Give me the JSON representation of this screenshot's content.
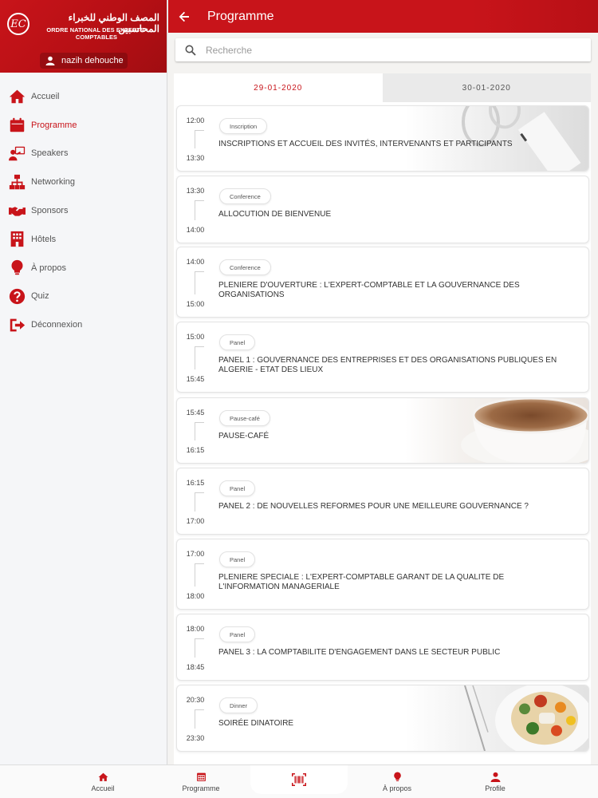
{
  "sidebar": {
    "logo_mark": "EC",
    "org_name_ar": "المصف الوطني للخبراء المحاسبين",
    "org_name_fr": "ORDRE NATIONAL DES EXPERTS-COMPTABLES",
    "user_name": "nazih dehouche",
    "items": [
      {
        "label": "Accueil",
        "icon": "home-icon"
      },
      {
        "label": "Programme",
        "icon": "calendar-icon",
        "active": true
      },
      {
        "label": "Speakers",
        "icon": "presenter-icon"
      },
      {
        "label": "Networking",
        "icon": "network-icon"
      },
      {
        "label": "Sponsors",
        "icon": "handshake-icon"
      },
      {
        "label": "Hôtels",
        "icon": "hotel-icon"
      },
      {
        "label": "À propos",
        "icon": "lightbulb-icon"
      },
      {
        "label": "Quiz",
        "icon": "question-icon"
      },
      {
        "label": "Déconnexion",
        "icon": "logout-icon"
      }
    ]
  },
  "header": {
    "title": "Programme"
  },
  "search": {
    "placeholder": "Recherche"
  },
  "tabs": [
    {
      "label": "29-01-2020",
      "active": true
    },
    {
      "label": "30-01-2020",
      "active": false
    }
  ],
  "sessions": [
    {
      "start": "12:00",
      "end": "13:30",
      "type": "Inscription",
      "title": "INSCRIPTIONS ET ACCUEIL DES INVITÉS, INTERVENANTS ET PARTICIPANTS",
      "image": "desk-image"
    },
    {
      "start": "13:30",
      "end": "14:00",
      "type": "Conference",
      "title": "ALLOCUTION DE BIENVENUE"
    },
    {
      "start": "14:00",
      "end": "15:00",
      "type": "Conference",
      "title": "PLENIERE D'OUVERTURE : L'EXPERT-COMPTABLE ET LA GOUVERNANCE DES ORGANISATIONS"
    },
    {
      "start": "15:00",
      "end": "15:45",
      "type": "Panel",
      "title": "PANEL 1 : GOUVERNANCE DES ENTREPRISES ET DES ORGANISATIONS PUBLIQUES EN ALGERIE - ETAT DES LIEUX"
    },
    {
      "start": "15:45",
      "end": "16:15",
      "type": "Pause-café",
      "title": "PAUSE-CAFÉ",
      "image": "coffee-image"
    },
    {
      "start": "16:15",
      "end": "17:00",
      "type": "Panel",
      "title": "PANEL 2 : DE NOUVELLES REFORMES POUR UNE MEILLEURE GOUVERNANCE ?"
    },
    {
      "start": "17:00",
      "end": "18:00",
      "type": "Panel",
      "title": "PLENIERE SPECIALE : L'EXPERT-COMPTABLE GARANT DE LA QUALITE DE L'INFORMATION MANAGERIALE"
    },
    {
      "start": "18:00",
      "end": "18:45",
      "type": "Panel",
      "title": "PANEL 3 : LA COMPTABILITE D'ENGAGEMENT DANS LE SECTEUR PUBLIC"
    },
    {
      "start": "20:30",
      "end": "23:30",
      "type": "Dinner",
      "title": "SOIRÉE DINATOIRE",
      "image": "food-image"
    }
  ],
  "bottom_nav": [
    {
      "label": "Accueil",
      "icon": "home-icon"
    },
    {
      "label": "Programme",
      "icon": "calendar-icon"
    },
    {
      "label": "",
      "icon": "barcode-scan-icon"
    },
    {
      "label": "À propos",
      "icon": "lightbulb-icon"
    },
    {
      "label": "Profile",
      "icon": "user-icon"
    }
  ],
  "colors": {
    "accent": "#c8141a",
    "background": "#f4f3f1"
  }
}
